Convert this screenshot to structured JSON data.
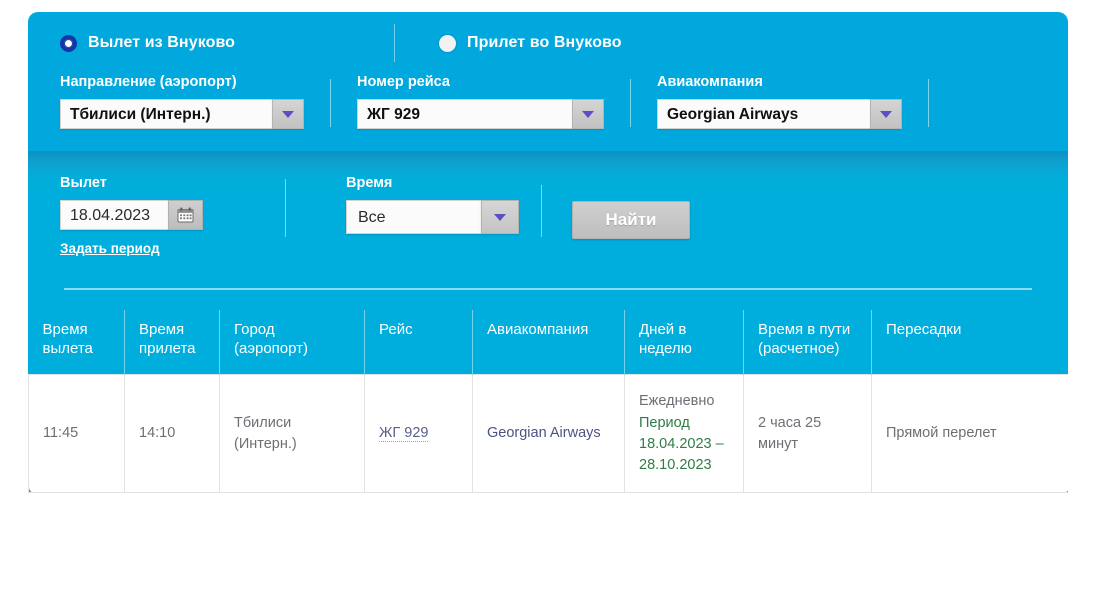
{
  "direction": {
    "options": [
      {
        "label": "Вылет из Внуково",
        "selected": true
      },
      {
        "label": "Прилет во Внуково",
        "selected": false
      }
    ]
  },
  "search_form": {
    "destination": {
      "label": "Направление (аэропорт)",
      "value": "Тбилиси (Интерн.)"
    },
    "flight_number": {
      "label": "Номер рейса",
      "value": "ЖГ 929"
    },
    "airline": {
      "label": "Авиакомпания",
      "value": "Georgian Airways"
    },
    "departure": {
      "label": "Вылет",
      "value": "18.04.2023",
      "period_link": "Задать период",
      "calendar_icon": "calendar-icon"
    },
    "time": {
      "label": "Время",
      "value": "Все"
    },
    "submit_label": "Найти"
  },
  "schedule": {
    "columns": [
      "Время вылета",
      "Время прилета",
      "Город (аэропорт)",
      "Рейс",
      "Авиакомпания",
      "Дней в неделю",
      "Время в пути (расчетное)",
      "Пересадки"
    ],
    "rows": [
      {
        "departure_time": "11:45",
        "arrival_time": "14:10",
        "city": "Тбилиси (Интерн.)",
        "flight": "ЖГ 929",
        "airline": "Georgian Airways",
        "days_main": "Ежедневно",
        "days_period": "Период 18.04.2023 – 28.10.2023",
        "duration": "2 часа 25 минут",
        "transfers": "Прямой перелет"
      }
    ]
  },
  "colors": {
    "panel_blue": "#00a8dd",
    "panel_blue_dark": "#0c93c4",
    "accent_green": "#2f7d45",
    "link_navy": "#4a5383",
    "radio_selected": "#1437a8"
  }
}
